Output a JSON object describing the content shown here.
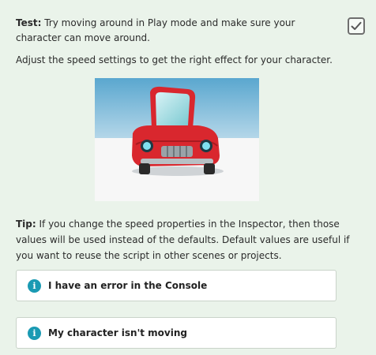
{
  "test": {
    "label": "Test:",
    "text": " Try moving around in Play mode and make sure your character can move around."
  },
  "checkbox": {
    "checked": true,
    "icon": "checkmark-icon"
  },
  "adjust_text": "Adjust the speed settings to get the right effect for your character.",
  "image": {
    "subject": "red cartoon car character"
  },
  "tip": {
    "label": "Tip:",
    "text": " If you change the speed properties in the Inspector, then those values will be used instead of the defaults. Default values are useful if you want to reuse the script in other scenes or projects."
  },
  "help_items": [
    {
      "icon": "info-icon",
      "label": "I have an error in the Console"
    },
    {
      "icon": "info-icon",
      "label": "My character isn't moving"
    }
  ],
  "colors": {
    "panel_bg": "#eaf3ea",
    "info_icon": "#1a9ab3",
    "car_red": "#d9272e"
  }
}
